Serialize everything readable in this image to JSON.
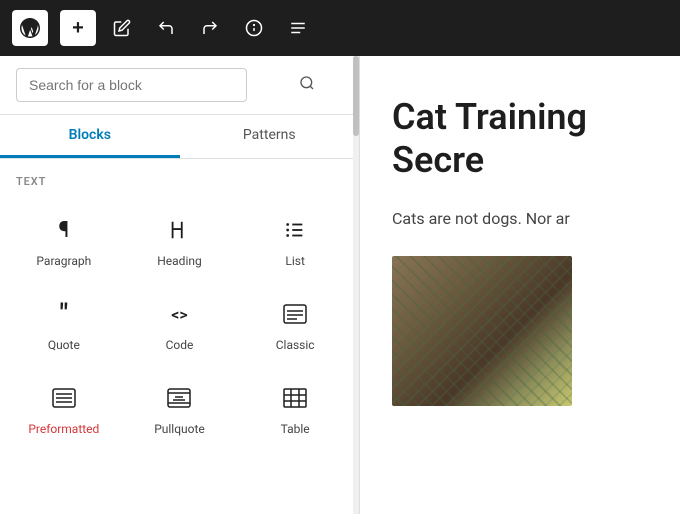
{
  "toolbar": {
    "add_label": "+",
    "wp_logo_alt": "WordPress",
    "buttons": [
      "add",
      "edit",
      "undo",
      "redo",
      "info",
      "list-view"
    ]
  },
  "sidebar": {
    "search_placeholder": "Search for a block",
    "tabs": [
      {
        "id": "blocks",
        "label": "Blocks",
        "active": true
      },
      {
        "id": "patterns",
        "label": "Patterns",
        "active": false
      }
    ],
    "section_label": "TEXT",
    "blocks": [
      {
        "id": "paragraph",
        "label": "Paragraph",
        "icon": "¶"
      },
      {
        "id": "heading",
        "label": "Heading",
        "icon": "🔖"
      },
      {
        "id": "list",
        "label": "List",
        "icon": "≡"
      },
      {
        "id": "quote",
        "label": "Quote",
        "icon": "❝"
      },
      {
        "id": "code",
        "label": "Code",
        "icon": "<>"
      },
      {
        "id": "classic",
        "label": "Classic",
        "icon": "⌨"
      },
      {
        "id": "preformatted",
        "label": "Preformatted",
        "icon": "▤",
        "orange": true
      },
      {
        "id": "pullquote",
        "label": "Pullquote",
        "icon": "▬"
      },
      {
        "id": "table",
        "label": "Table",
        "icon": "⊞"
      }
    ]
  },
  "editor": {
    "title": "Cat Training Secre",
    "content": "Cats are not dogs. Nor ar",
    "image_alt": "Cat training image"
  },
  "colors": {
    "accent": "#007cba",
    "orange": "#d63638",
    "toolbar_bg": "#1e1e1e"
  }
}
